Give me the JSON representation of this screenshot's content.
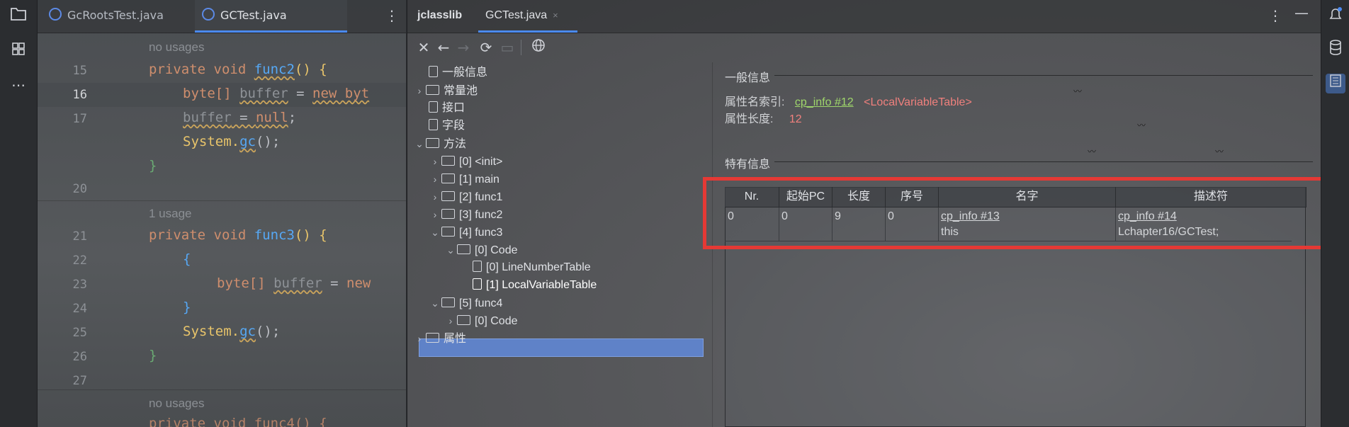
{
  "editor": {
    "tabs": [
      {
        "label": "GcRootsTest.java"
      },
      {
        "label": "GCTest.java"
      }
    ],
    "hints": {
      "no_usages_1": "no usages",
      "usage_1": "1 usage",
      "no_usages_2": "no usages"
    },
    "line_numbers": [
      "15",
      "16",
      "17",
      "20",
      "21",
      "22",
      "23",
      "24",
      "25",
      "26",
      "27"
    ],
    "code": {
      "l15_kw": "private void ",
      "l15_fn": "func2",
      "l15_rest": "() {",
      "l16_ty": "byte[] ",
      "l16_var": "buffer",
      "l16_eq": " = ",
      "l16_new": "new byt",
      "l17_var": "buffer",
      "l17_eq": " = ",
      "l17_null": "null",
      "l17_end": ";",
      "l18_sys": "System.",
      "l18_gc": "gc",
      "l18_end": "();",
      "l19": "}",
      "l21_kw": "private void ",
      "l21_fn": "func3",
      "l21_rest": "() {",
      "l22": "{",
      "l23_ty": "byte[] ",
      "l23_var": "buffer",
      "l23_eq": " = ",
      "l23_new": "new",
      "l24": "}",
      "l25_sys": "System.",
      "l25_gc": "gc",
      "l25_end": "();",
      "l26": "}",
      "l_last": "private void func4() {"
    }
  },
  "jclasslib": {
    "tab_title": "jclasslib",
    "tab_file": "GCTest.java",
    "tree": {
      "general": "一般信息",
      "constant_pool": "常量池",
      "interfaces": "接口",
      "fields": "字段",
      "methods": "方法",
      "m0": "[0] <init>",
      "m1": "[1] main",
      "m2": "[2] func1",
      "m3": "[3] func2",
      "m4": "[4] func3",
      "m4_code": "[0] Code",
      "m4_lnt": "[0] LineNumberTable",
      "m4_lvt": "[1] LocalVariableTable",
      "m5": "[5] func4",
      "m5_code": "[0] Code",
      "attributes": "属性"
    },
    "info": {
      "general_title": "一般信息",
      "attr_name_label": "属性名索引:",
      "attr_name_link": "cp_info #12",
      "attr_name_value": "<LocalVariableTable>",
      "attr_len_label": "属性长度:",
      "attr_len_value": "12",
      "specific_title": "特有信息"
    },
    "table": {
      "headers": [
        "Nr.",
        "起始PC",
        "长度",
        "序号",
        "名字",
        "描述符"
      ],
      "row": {
        "nr": "0",
        "start_pc": "0",
        "length": "9",
        "index": "0",
        "name_link": "cp_info #13",
        "name": "this",
        "desc_link": "cp_info #14",
        "desc": "Lchapter16/GCTest;"
      }
    }
  },
  "colors": {
    "accent": "#4b8af0",
    "highlight_box": "#e53935",
    "link": "#9fd66b",
    "red_text": "#f0807d",
    "selection": "#5f82c8"
  },
  "icons": [
    "folder-icon",
    "structure-icon",
    "more-icon",
    "close-icon",
    "back-icon",
    "refresh-icon",
    "web-icon",
    "notifications-icon",
    "database-icon",
    "jclasslib-icon"
  ]
}
